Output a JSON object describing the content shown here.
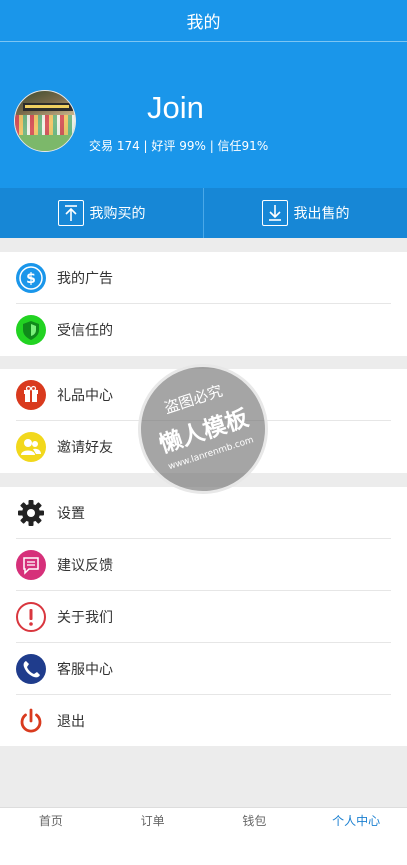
{
  "header": {
    "title": "我的"
  },
  "profile": {
    "username": "Join",
    "stats": "交易 174 | 好评 99% | 信任91%"
  },
  "trade": {
    "buy_label": "我购买的",
    "sell_label": "我出售的"
  },
  "menu": {
    "group1": [
      {
        "label": "我的广告",
        "icon": "dollar-icon",
        "color": "#1a96ea"
      },
      {
        "label": "受信任的",
        "icon": "shield-icon",
        "color": "#22d322"
      }
    ],
    "group2": [
      {
        "label": "礼品中心",
        "icon": "gift-icon",
        "color": "#d93a1e"
      },
      {
        "label": "邀请好友",
        "icon": "users-icon",
        "color": "#f2d81c"
      }
    ],
    "group3": [
      {
        "label": "设置",
        "icon": "gear-icon",
        "color": "#222222"
      },
      {
        "label": "建议反馈",
        "icon": "feedback-icon",
        "color": "#d6307a"
      },
      {
        "label": "关于我们",
        "icon": "exclamation-icon",
        "color": "#d9363e"
      },
      {
        "label": "客服中心",
        "icon": "phone-icon",
        "color": "#1f3c8c"
      },
      {
        "label": "退出",
        "icon": "power-icon",
        "color": "#d93a1e"
      }
    ]
  },
  "watermark": {
    "line1": "盗图必究",
    "line2": "懒人模板",
    "line3": "www.lanrenmb.com"
  },
  "tabs": [
    {
      "label": "首页"
    },
    {
      "label": "订单"
    },
    {
      "label": "钱包"
    },
    {
      "label": "个人中心",
      "active": true
    }
  ]
}
